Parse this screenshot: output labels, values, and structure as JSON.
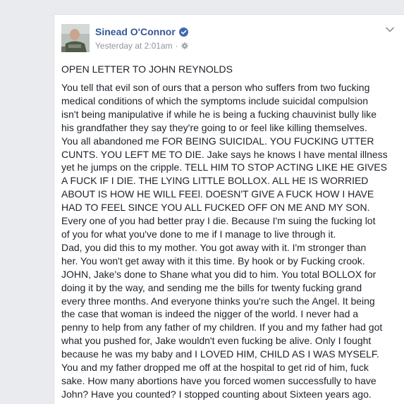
{
  "post": {
    "author": "Sinead O'Connor",
    "timestamp": "Yesterday at 2:01am",
    "separator": "·",
    "privacy_icon": "gear-icon",
    "verified_icon": "verified-badge-icon",
    "menu_icon": "chevron-down-icon",
    "accent_color": "#365899",
    "verified_color": "#4267b2",
    "title": "OPEN LETTER TO JOHN REYNOLDS",
    "body_lines": [
      "You tell that evil son of ours that a person who suffers from two fucking",
      "medical conditions of which the symptoms include suicidal compulsion",
      "isn't being manipulative if while he is being a fucking chauvinist bully like",
      "his grandfather they say they're going to or feel like killing themselves.",
      "You all abandoned me FOR BEING SUICIDAL. YOU FUCKING UTTER",
      "CUNTS. YOU LEFT ME TO DIE. Jake says he knows I have mental illness",
      "yet he jumps on the cripple. TELL HIM TO STOP ACTING LIKE HE GIVES",
      "A FUCK IF I DIE. THE LYING LITTLE BOLLOX. ALL HE IS WORRIED",
      "ABOUT IS HOW HE WILL FEEl. DOESN'T GIVE A FUCK HOW I HAVE",
      "HAD TO FEEL SINCE YOU ALL FUCKED OFF ON ME AND MY SON.",
      "Every one of you had better pray I die. Because I'm suing the fucking lot",
      "of you for what you've done to me if I manage to live through it.",
      "Dad, you did this to my mother. You got away with it. I'm stronger than",
      "her. You won't get away with it this time. By hook or by Fucking crook.",
      "JOHN, Jake's done to Shane what you did to him. You total BOLLOX for",
      "doing it by the way, and sending me the bills for twenty fucking grand",
      "every three months. And everyone thinks you're such the Angel. It being",
      "the case that woman is indeed the nigger of the world. I never had a",
      "penny to help from any father of my children. If you and my father had got",
      "what you pushed for, Jake wouldn't even fucking be alive. Only I fought",
      "because he was my baby and I LOVED HIM, CHILD AS I WAS MYSELF.",
      "You and my father dropped me off at the hospital to get rid of him, fuck",
      "sake. How many abortions have you forced women successfully to have",
      "John? Have you counted? I stopped counting about Sixteen years ago."
    ]
  }
}
